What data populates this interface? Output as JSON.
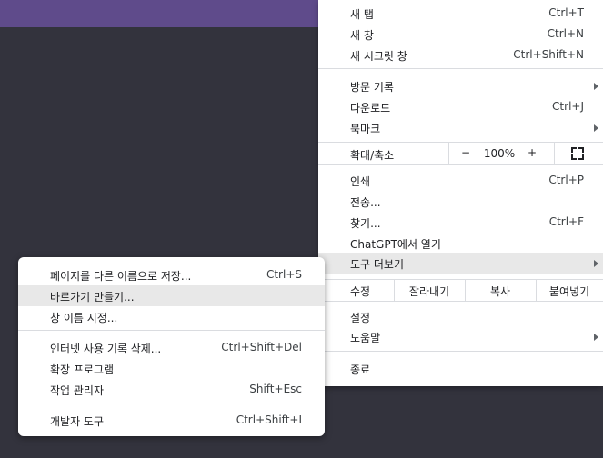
{
  "menu": {
    "new_tab": {
      "label": "새 탭",
      "shortcut": "Ctrl+T"
    },
    "new_window": {
      "label": "새 창",
      "shortcut": "Ctrl+N"
    },
    "incognito": {
      "label": "새 시크릿 창",
      "shortcut": "Ctrl+Shift+N"
    },
    "history": {
      "label": "방문 기록"
    },
    "downloads": {
      "label": "다운로드",
      "shortcut": "Ctrl+J"
    },
    "bookmarks": {
      "label": "북마크"
    },
    "zoom": {
      "label": "확대/축소",
      "minus": "−",
      "value": "100%",
      "plus": "+"
    },
    "print": {
      "label": "인쇄",
      "shortcut": "Ctrl+P"
    },
    "cast": {
      "label": "전송..."
    },
    "find": {
      "label": "찾기...",
      "shortcut": "Ctrl+F"
    },
    "chatgpt": {
      "label": "ChatGPT에서 열기"
    },
    "more_tools": {
      "label": "도구 더보기"
    },
    "edit": {
      "label": "수정",
      "cut": "잘라내기",
      "copy": "복사",
      "paste": "붙여넣기"
    },
    "settings": {
      "label": "설정"
    },
    "help": {
      "label": "도움말"
    },
    "exit": {
      "label": "종료"
    }
  },
  "submenu": {
    "save_page": {
      "label": "페이지를 다른 이름으로 저장...",
      "shortcut": "Ctrl+S"
    },
    "create_shortcut": {
      "label": "바로가기 만들기..."
    },
    "name_window": {
      "label": "창 이름 지정..."
    },
    "clear_data": {
      "label": "인터넷 사용 기록 삭제...",
      "shortcut": "Ctrl+Shift+Del"
    },
    "extensions": {
      "label": "확장 프로그램"
    },
    "task_manager": {
      "label": "작업 관리자",
      "shortcut": "Shift+Esc"
    },
    "dev_tools": {
      "label": "개발자 도구",
      "shortcut": "Ctrl+Shift+I"
    }
  },
  "colors": {
    "background": "#33333d",
    "tabbar": "#5f4b8b",
    "highlight": "#e8e8e8"
  }
}
